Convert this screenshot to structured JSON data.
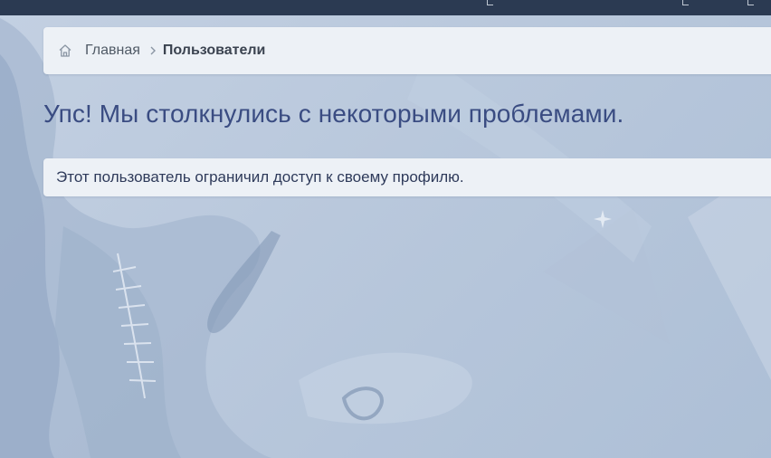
{
  "breadcrumb": {
    "home_icon": "home-icon",
    "home_label": "Главная",
    "separator_icon": "chevron-right-icon",
    "current_label": "Пользователи"
  },
  "error": {
    "title": "Упс! Мы столкнулись с некоторыми проблемами.",
    "message": "Этот пользователь ограничил доступ к своему профилю."
  },
  "colors": {
    "topbar": "#2b3a52",
    "panel": "#edf1f6",
    "title": "#3a4c82",
    "background": "#b9c8dc"
  }
}
